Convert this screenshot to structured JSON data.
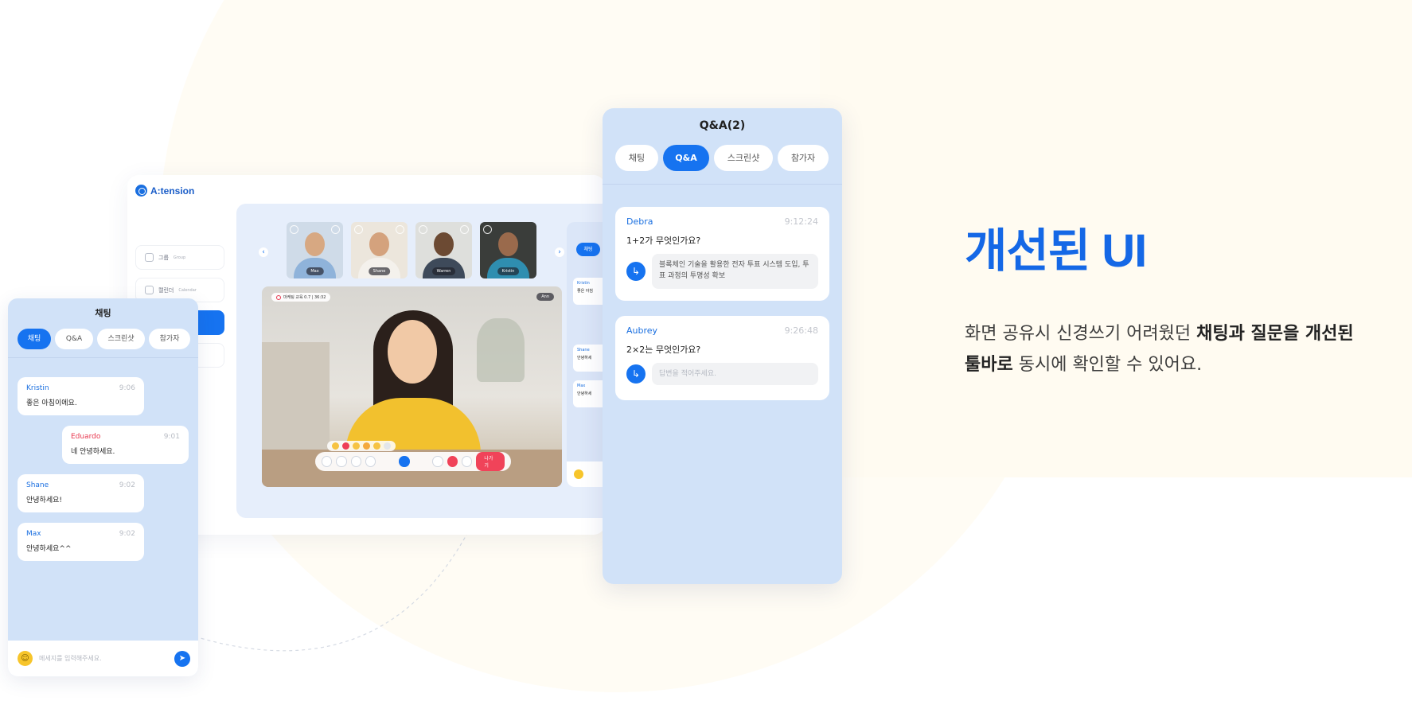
{
  "app": {
    "logo_text": "A:tension",
    "nav": [
      {
        "label": "그룹",
        "sub": "Group"
      },
      {
        "label": "캘린더",
        "sub": "Calendar"
      }
    ],
    "participants": [
      "Max",
      "Shane",
      "Warren",
      "Kristin"
    ],
    "recording_text": "마케팅 교육 0.7  |  36:32",
    "host_tag": "Ann",
    "exit_label": "나가기",
    "side_strip": {
      "tab_label": "채팅",
      "messages": [
        {
          "name": "Kristin",
          "text": "좋은 아침"
        },
        {
          "name": "Shane",
          "text": "안녕하세"
        },
        {
          "name": "Max",
          "text": "안녕하세"
        }
      ]
    }
  },
  "chat_panel": {
    "title": "채팅",
    "tabs": [
      "채팅",
      "Q&A",
      "스크린샷",
      "참가자"
    ],
    "active_tab": "채팅",
    "messages": [
      {
        "name": "Kristin",
        "time": "9:06",
        "text": "좋은 아침이에요."
      },
      {
        "name": "Eduardo",
        "time": "9:01",
        "text": "네 안녕하세요."
      },
      {
        "name": "Shane",
        "time": "9:02",
        "text": "안녕하세요!"
      },
      {
        "name": "Max",
        "time": "9:02",
        "text": "안녕하세요^^"
      }
    ],
    "input_placeholder": "메세지를 입력해주세요."
  },
  "qa_panel": {
    "title": "Q&A(2)",
    "tabs": [
      "채팅",
      "Q&A",
      "스크린샷",
      "참가자"
    ],
    "active_tab": "Q&A",
    "questions": [
      {
        "name": "Debra",
        "time": "9:12:24",
        "question": "1+2가 무엇인가요?",
        "answer": "블록체인 기술을 활용한 전자 투표 시스템 도입, 투표 과정의 투명성 확보"
      },
      {
        "name": "Aubrey",
        "time": "9:26:48",
        "question": "2×2는 무엇인가요?",
        "answer_placeholder": "답변을 적어주세요."
      }
    ]
  },
  "marketing": {
    "headline": "개선된 UI",
    "desc_1": "화면 공유시 신경쓰기 어려웠던 ",
    "desc_bold_1": "채팅과 질문을 개선된",
    "desc_bold_2": "툴바로",
    "desc_2": " 동시에 확인할 수 있어요."
  },
  "colors": {
    "accent": "#1673f0",
    "headline": "#1568e6",
    "panel_bg": "#d1e2f8",
    "cream_bg": "#fffbf1",
    "alert": "#e8384f"
  },
  "icons": [
    "logo-icon",
    "group-icon",
    "calendar-icon",
    "chevron-left-icon",
    "chevron-right-icon",
    "record-icon",
    "smile-icon",
    "send-icon",
    "reply-icon"
  ]
}
